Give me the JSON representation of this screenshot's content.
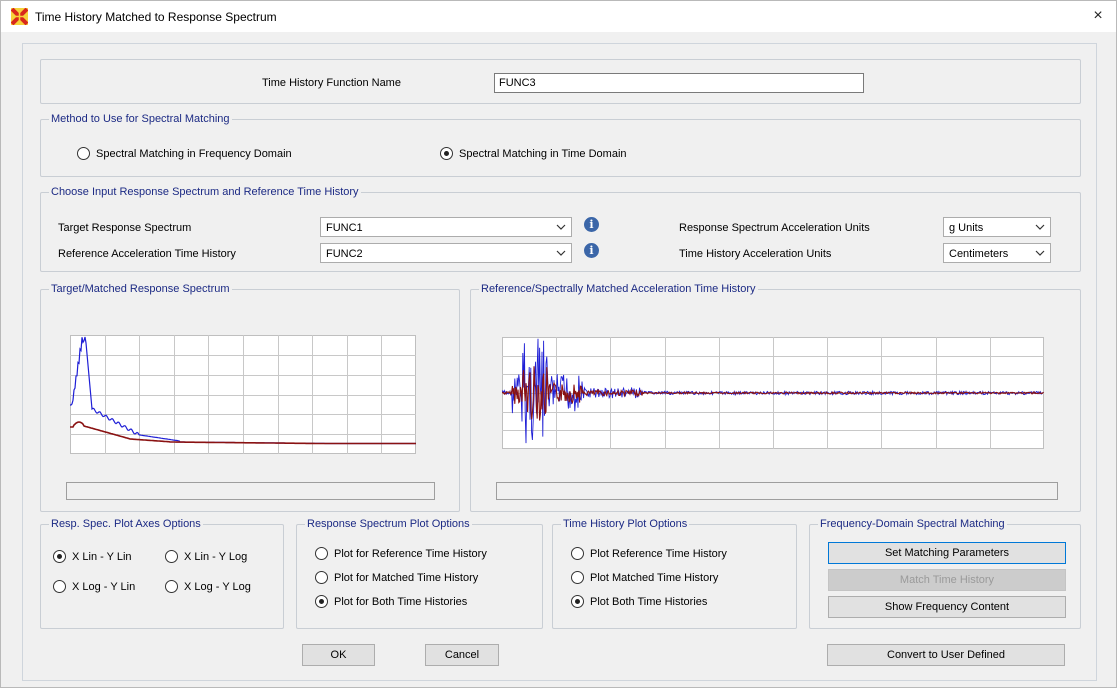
{
  "window": {
    "title": "Time History Matched to Response Spectrum",
    "close_glyph": "×"
  },
  "name_row": {
    "label": "Time History Function Name",
    "value": "FUNC3"
  },
  "method": {
    "legend": "Method to Use for Spectral Matching",
    "options": [
      {
        "label": "Spectral Matching in Frequency Domain",
        "selected": false
      },
      {
        "label": "Spectral Matching in Time Domain",
        "selected": true
      }
    ]
  },
  "inputs": {
    "legend": "Choose Input Response Spectrum and Reference Time History",
    "target_label": "Target Response Spectrum",
    "target_value": "FUNC1",
    "reference_label": "Reference Acceleration Time History",
    "reference_value": "FUNC2",
    "rs_units_label": "Response Spectrum Acceleration Units",
    "rs_units_value": "g Units",
    "th_units_label": "Time History Acceleration Units",
    "th_units_value": "Centimeters",
    "info_glyph": "i"
  },
  "plots": {
    "spectrum_legend": "Target/Matched Response Spectrum",
    "history_legend": "Reference/Spectrally Matched Acceleration Time History",
    "colors": {
      "target": "#1f1fd6",
      "matched": "#8a1212",
      "grid": "#c8c8c8"
    }
  },
  "axes_options": {
    "legend": "Resp. Spec. Plot Axes Options",
    "options": [
      {
        "label": "X Lin - Y Lin",
        "selected": true
      },
      {
        "label": "X Lin - Y Log",
        "selected": false
      },
      {
        "label": "X Log - Y Lin",
        "selected": false
      },
      {
        "label": "X Log - Y Log",
        "selected": false
      }
    ]
  },
  "rs_plot_options": {
    "legend": "Response Spectrum Plot Options",
    "options": [
      {
        "label": "Plot for Reference Time History",
        "selected": false
      },
      {
        "label": "Plot for Matched Time History",
        "selected": false
      },
      {
        "label": "Plot for Both Time Histories",
        "selected": true
      }
    ]
  },
  "th_plot_options": {
    "legend": "Time History Plot Options",
    "options": [
      {
        "label": "Plot Reference Time History",
        "selected": false
      },
      {
        "label": "Plot Matched Time History",
        "selected": false
      },
      {
        "label": "Plot Both Time Histories",
        "selected": true
      }
    ]
  },
  "freq_domain": {
    "legend": "Frequency-Domain Spectral Matching",
    "set_params": "Set Matching Parameters",
    "match": "Match Time History",
    "show_freq": "Show Frequency Content"
  },
  "footer": {
    "ok": "OK",
    "cancel": "Cancel",
    "convert": "Convert to User Defined"
  }
}
